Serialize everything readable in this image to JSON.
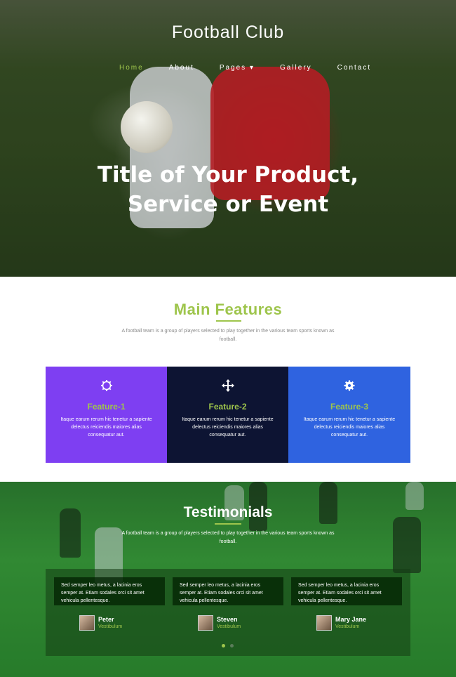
{
  "brand": "Football Club",
  "nav": {
    "items": [
      {
        "label": "Home"
      },
      {
        "label": "About"
      },
      {
        "label": "Pages ▾"
      },
      {
        "label": "Gallery"
      },
      {
        "label": "Contact"
      }
    ]
  },
  "hero": {
    "title_line1": "Title of Your Product,",
    "title_line2": "Service or Event"
  },
  "features": {
    "heading": "Main Features",
    "description": "A football team is a group of players selected to play together in the various team sports known as football.",
    "items": [
      {
        "icon": "gear-outline-icon",
        "title": "Feature-1",
        "text": "Itaque earum rerum hic tenetur a sapiente delectus reiciendis maiores alias consequatur aut."
      },
      {
        "icon": "move-arrows-icon",
        "title": "Feature-2",
        "text": "Itaque earum rerum hic tenetur a sapiente delectus reiciendis maiores alias consequatur aut."
      },
      {
        "icon": "gear-icon",
        "title": "Feature-3",
        "text": "Itaque earum rerum hic tenetur a sapiente delectus reiciendis maiores alias consequatur aut."
      }
    ],
    "colors": {
      "feature1": "#7e3ff2",
      "feature2": "#0d1433",
      "feature3": "#2f63e0",
      "accent": "#9ec54c"
    }
  },
  "testimonials": {
    "heading": "Testimonials",
    "description": "A football team is a group of players selected to play together in the various team sports known as football.",
    "items": [
      {
        "quote": "Sed semper leo metus, a lacinia eros semper at. Etiam sodales orci sit amet vehicula pellentesque.",
        "name": "Peter",
        "role": "Vestibulum"
      },
      {
        "quote": "Sed semper leo metus, a lacinia eros semper at. Etiam sodales orci sit amet vehicula pellentesque.",
        "name": "Steven",
        "role": "Vestibulum"
      },
      {
        "quote": "Sed semper leo metus, a lacinia eros semper at. Etiam sodales orci sit amet vehicula pellentesque.",
        "name": "Mary Jane",
        "role": "Vestibulum"
      }
    ]
  }
}
